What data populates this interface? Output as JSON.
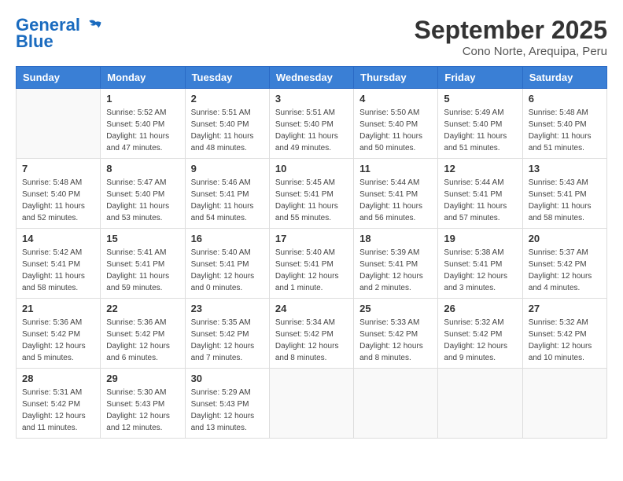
{
  "header": {
    "logo_line1": "General",
    "logo_line2": "Blue",
    "month": "September 2025",
    "location": "Cono Norte, Arequipa, Peru"
  },
  "weekdays": [
    "Sunday",
    "Monday",
    "Tuesday",
    "Wednesday",
    "Thursday",
    "Friday",
    "Saturday"
  ],
  "weeks": [
    [
      {
        "day": "",
        "info": ""
      },
      {
        "day": "1",
        "info": "Sunrise: 5:52 AM\nSunset: 5:40 PM\nDaylight: 11 hours\nand 47 minutes."
      },
      {
        "day": "2",
        "info": "Sunrise: 5:51 AM\nSunset: 5:40 PM\nDaylight: 11 hours\nand 48 minutes."
      },
      {
        "day": "3",
        "info": "Sunrise: 5:51 AM\nSunset: 5:40 PM\nDaylight: 11 hours\nand 49 minutes."
      },
      {
        "day": "4",
        "info": "Sunrise: 5:50 AM\nSunset: 5:40 PM\nDaylight: 11 hours\nand 50 minutes."
      },
      {
        "day": "5",
        "info": "Sunrise: 5:49 AM\nSunset: 5:40 PM\nDaylight: 11 hours\nand 51 minutes."
      },
      {
        "day": "6",
        "info": "Sunrise: 5:48 AM\nSunset: 5:40 PM\nDaylight: 11 hours\nand 51 minutes."
      }
    ],
    [
      {
        "day": "7",
        "info": "Sunrise: 5:48 AM\nSunset: 5:40 PM\nDaylight: 11 hours\nand 52 minutes."
      },
      {
        "day": "8",
        "info": "Sunrise: 5:47 AM\nSunset: 5:40 PM\nDaylight: 11 hours\nand 53 minutes."
      },
      {
        "day": "9",
        "info": "Sunrise: 5:46 AM\nSunset: 5:41 PM\nDaylight: 11 hours\nand 54 minutes."
      },
      {
        "day": "10",
        "info": "Sunrise: 5:45 AM\nSunset: 5:41 PM\nDaylight: 11 hours\nand 55 minutes."
      },
      {
        "day": "11",
        "info": "Sunrise: 5:44 AM\nSunset: 5:41 PM\nDaylight: 11 hours\nand 56 minutes."
      },
      {
        "day": "12",
        "info": "Sunrise: 5:44 AM\nSunset: 5:41 PM\nDaylight: 11 hours\nand 57 minutes."
      },
      {
        "day": "13",
        "info": "Sunrise: 5:43 AM\nSunset: 5:41 PM\nDaylight: 11 hours\nand 58 minutes."
      }
    ],
    [
      {
        "day": "14",
        "info": "Sunrise: 5:42 AM\nSunset: 5:41 PM\nDaylight: 11 hours\nand 58 minutes."
      },
      {
        "day": "15",
        "info": "Sunrise: 5:41 AM\nSunset: 5:41 PM\nDaylight: 11 hours\nand 59 minutes."
      },
      {
        "day": "16",
        "info": "Sunrise: 5:40 AM\nSunset: 5:41 PM\nDaylight: 12 hours\nand 0 minutes."
      },
      {
        "day": "17",
        "info": "Sunrise: 5:40 AM\nSunset: 5:41 PM\nDaylight: 12 hours\nand 1 minute."
      },
      {
        "day": "18",
        "info": "Sunrise: 5:39 AM\nSunset: 5:41 PM\nDaylight: 12 hours\nand 2 minutes."
      },
      {
        "day": "19",
        "info": "Sunrise: 5:38 AM\nSunset: 5:41 PM\nDaylight: 12 hours\nand 3 minutes."
      },
      {
        "day": "20",
        "info": "Sunrise: 5:37 AM\nSunset: 5:42 PM\nDaylight: 12 hours\nand 4 minutes."
      }
    ],
    [
      {
        "day": "21",
        "info": "Sunrise: 5:36 AM\nSunset: 5:42 PM\nDaylight: 12 hours\nand 5 minutes."
      },
      {
        "day": "22",
        "info": "Sunrise: 5:36 AM\nSunset: 5:42 PM\nDaylight: 12 hours\nand 6 minutes."
      },
      {
        "day": "23",
        "info": "Sunrise: 5:35 AM\nSunset: 5:42 PM\nDaylight: 12 hours\nand 7 minutes."
      },
      {
        "day": "24",
        "info": "Sunrise: 5:34 AM\nSunset: 5:42 PM\nDaylight: 12 hours\nand 8 minutes."
      },
      {
        "day": "25",
        "info": "Sunrise: 5:33 AM\nSunset: 5:42 PM\nDaylight: 12 hours\nand 8 minutes."
      },
      {
        "day": "26",
        "info": "Sunrise: 5:32 AM\nSunset: 5:42 PM\nDaylight: 12 hours\nand 9 minutes."
      },
      {
        "day": "27",
        "info": "Sunrise: 5:32 AM\nSunset: 5:42 PM\nDaylight: 12 hours\nand 10 minutes."
      }
    ],
    [
      {
        "day": "28",
        "info": "Sunrise: 5:31 AM\nSunset: 5:42 PM\nDaylight: 12 hours\nand 11 minutes."
      },
      {
        "day": "29",
        "info": "Sunrise: 5:30 AM\nSunset: 5:43 PM\nDaylight: 12 hours\nand 12 minutes."
      },
      {
        "day": "30",
        "info": "Sunrise: 5:29 AM\nSunset: 5:43 PM\nDaylight: 12 hours\nand 13 minutes."
      },
      {
        "day": "",
        "info": ""
      },
      {
        "day": "",
        "info": ""
      },
      {
        "day": "",
        "info": ""
      },
      {
        "day": "",
        "info": ""
      }
    ]
  ]
}
